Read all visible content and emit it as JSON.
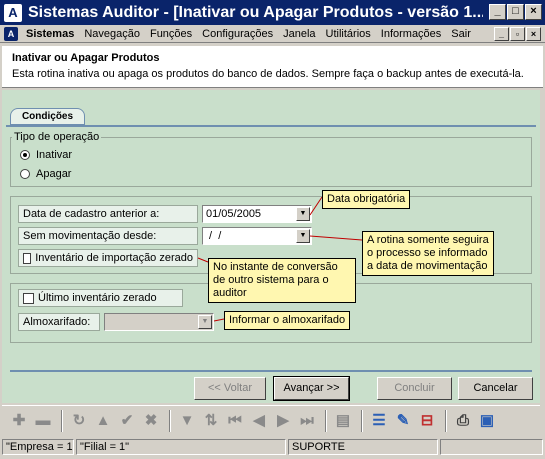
{
  "window": {
    "title": "Sistemas Auditor - [Inativar ou Apagar Produtos - versão 1...",
    "controls": {
      "minimize": "_",
      "maximize": "□",
      "close": "×"
    }
  },
  "menu": {
    "items": [
      "Sistemas",
      "Navegação",
      "Funções",
      "Configurações",
      "Janela",
      "Utilitários",
      "Informações",
      "Sair"
    ],
    "mdi_controls": {
      "minimize": "_",
      "restore": "▫",
      "close": "×"
    }
  },
  "header": {
    "title": "Inativar ou Apagar Produtos",
    "description": "Esta rotina inativa ou apaga os produtos do banco de dados. Sempre faça o backup antes de executá-la."
  },
  "tabs": [
    "Condições"
  ],
  "operation": {
    "legend": "Tipo de operação",
    "options": [
      "Inativar",
      "Apagar"
    ],
    "selected": "Inativar"
  },
  "fields": {
    "cadastro_label": "Data de cadastro anterior a:",
    "cadastro_value": "01/05/2005",
    "movimentacao_label": "Sem movimentação desde:",
    "movimentacao_value": " /  /",
    "inventario_importacao_label": "Inventário de importação zerado",
    "ultimo_inventario_label": "Último inventário zerado",
    "almoxarifado_label": "Almoxarifado:",
    "almoxarifado_value": ""
  },
  "notes": {
    "data_obrigatoria": "Data obrigatória",
    "movimentacao": "A rotina somente seguira o processo se informado a data de movimentação",
    "conversao": "No instante de conversão de outro sistema para o auditor",
    "almoxarifado": "Informar o almoxarifado"
  },
  "buttons": {
    "voltar": "<< Voltar",
    "avancar": "Avançar >>",
    "concluir": "Concluir",
    "cancelar": "Cancelar"
  },
  "toolbar_icons": [
    "plus-icon",
    "minus-icon",
    "refresh-icon",
    "triangle-up-icon",
    "check-icon",
    "x-icon",
    "filter-icon",
    "sort-icon",
    "first-record-icon",
    "prev-record-icon",
    "next-record-icon",
    "last-record-icon",
    "document-icon",
    "list-icon",
    "edit-icon",
    "delete-icon",
    "print-icon",
    "properties-icon"
  ],
  "status": {
    "empresa": "\"Empresa = 1\"",
    "filial": "\"Filial = 1\"",
    "user": "SUPORTE"
  }
}
